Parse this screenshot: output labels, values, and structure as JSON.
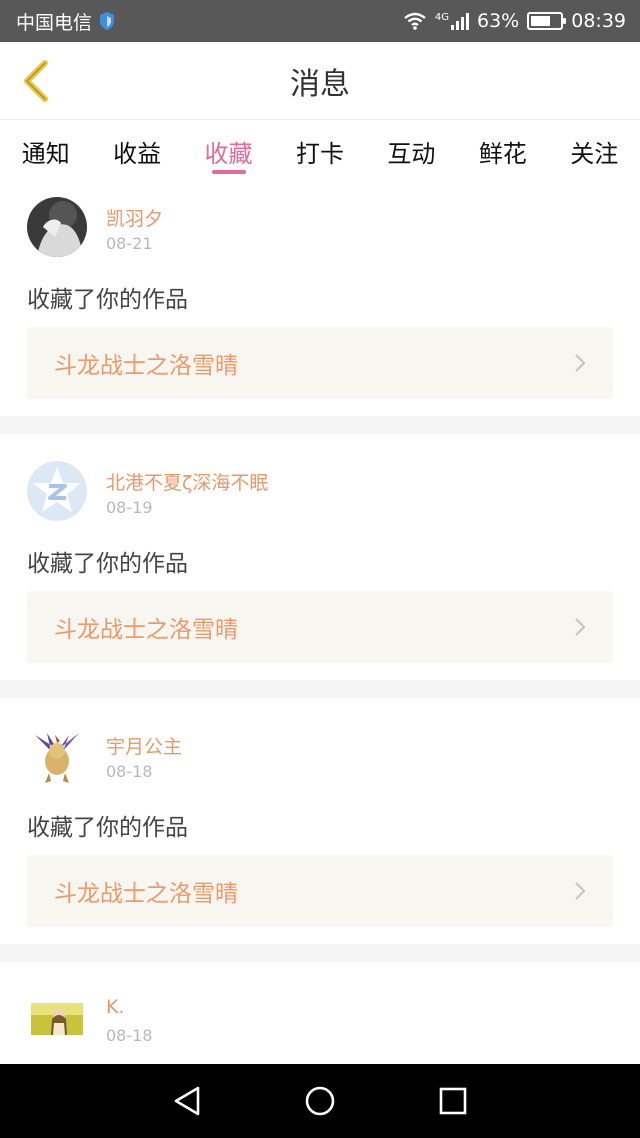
{
  "status_bar": {
    "carrier": "中国电信",
    "network": "4G",
    "battery": "63%",
    "time": "08:39"
  },
  "header": {
    "title": "消息"
  },
  "tabs": [
    {
      "label": "通知"
    },
    {
      "label": "收益"
    },
    {
      "label": "收藏",
      "active": true
    },
    {
      "label": "打卡"
    },
    {
      "label": "互动"
    },
    {
      "label": "鲜花"
    },
    {
      "label": "关注"
    }
  ],
  "messages": [
    {
      "user": "凯羽夕",
      "date": "08-21",
      "action": "收藏了你的作品",
      "work": "斗龙战士之洛雪晴"
    },
    {
      "user": "北港不夏ζ深海不眠",
      "date": "08-19",
      "action": "收藏了你的作品",
      "work": "斗龙战士之洛雪晴"
    },
    {
      "user": "宇月公主",
      "date": "08-18",
      "action": "收藏了你的作品",
      "work": "斗龙战士之洛雪晴"
    },
    {
      "user": "K.",
      "date": "08-18"
    }
  ],
  "colors": {
    "accent": "#e06b9c",
    "name": "#e59a6e",
    "work_title": "#eb9a6a",
    "back_icon": "#e8c640"
  }
}
